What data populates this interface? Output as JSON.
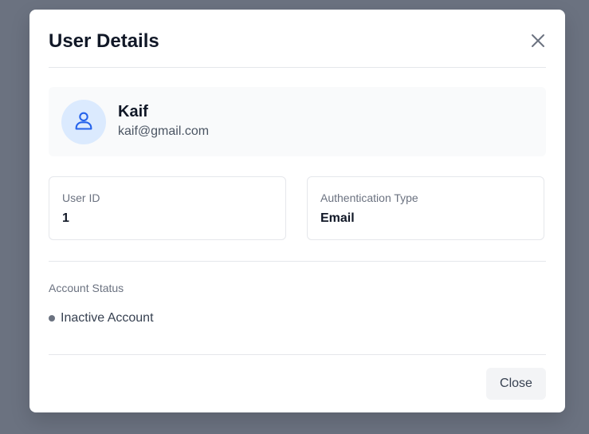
{
  "modal": {
    "title": "User Details",
    "close_icon": "close-icon",
    "close_button_label": "Close"
  },
  "profile": {
    "avatar_icon": "user-icon",
    "name": "Kaif",
    "email": "kaif@gmail.com"
  },
  "info": {
    "user_id_label": "User ID",
    "user_id_value": "1",
    "auth_type_label": "Authentication Type",
    "auth_type_value": "Email"
  },
  "status": {
    "label": "Account Status",
    "value": "Inactive Account",
    "dot_color": "#6b7280"
  },
  "colors": {
    "overlay": "#6b7280",
    "avatar_bg": "#dbeafe",
    "avatar_icon": "#2563eb"
  }
}
